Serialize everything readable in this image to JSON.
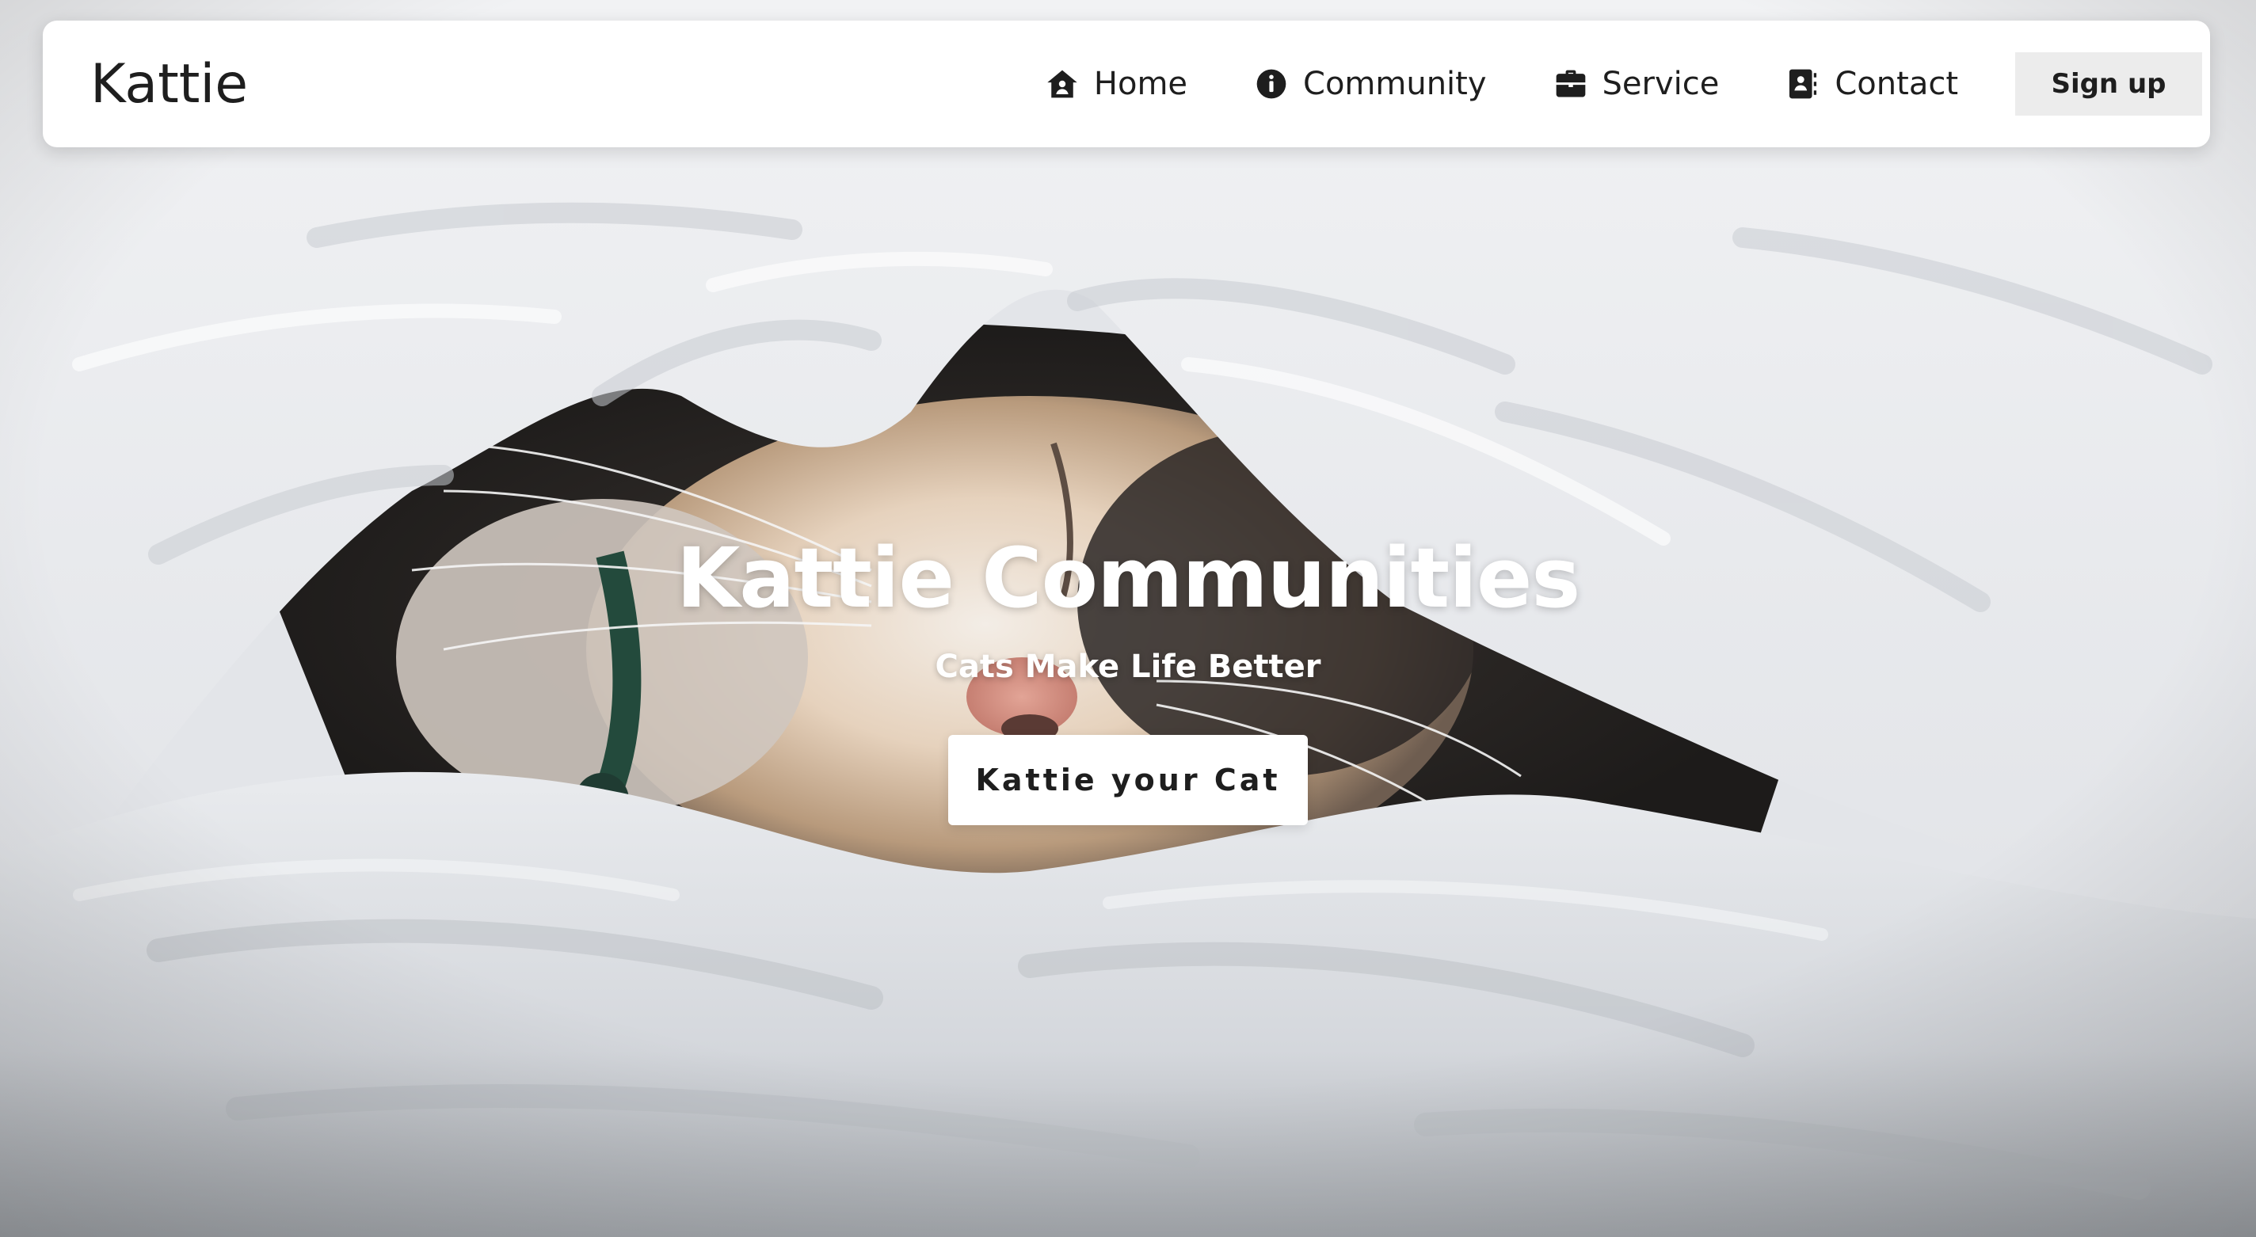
{
  "brand": {
    "name": "Kattie"
  },
  "nav": {
    "items": [
      {
        "label": "Home",
        "icon": "home-icon"
      },
      {
        "label": "Community",
        "icon": "info-icon"
      },
      {
        "label": "Service",
        "icon": "briefcase-icon"
      },
      {
        "label": "Contact",
        "icon": "contact-book-icon"
      }
    ],
    "signup_label": "Sign up"
  },
  "hero": {
    "title": "Kattie Communities",
    "subtitle": "Cats Make Life Better",
    "cta_label": "Kattie your Cat",
    "background": "cat-under-white-blanket-photo"
  },
  "colors": {
    "text_dark": "#1e1e1e",
    "navbar_bg": "#ffffff",
    "signup_bg": "#ececec",
    "hero_text": "#ffffff"
  }
}
